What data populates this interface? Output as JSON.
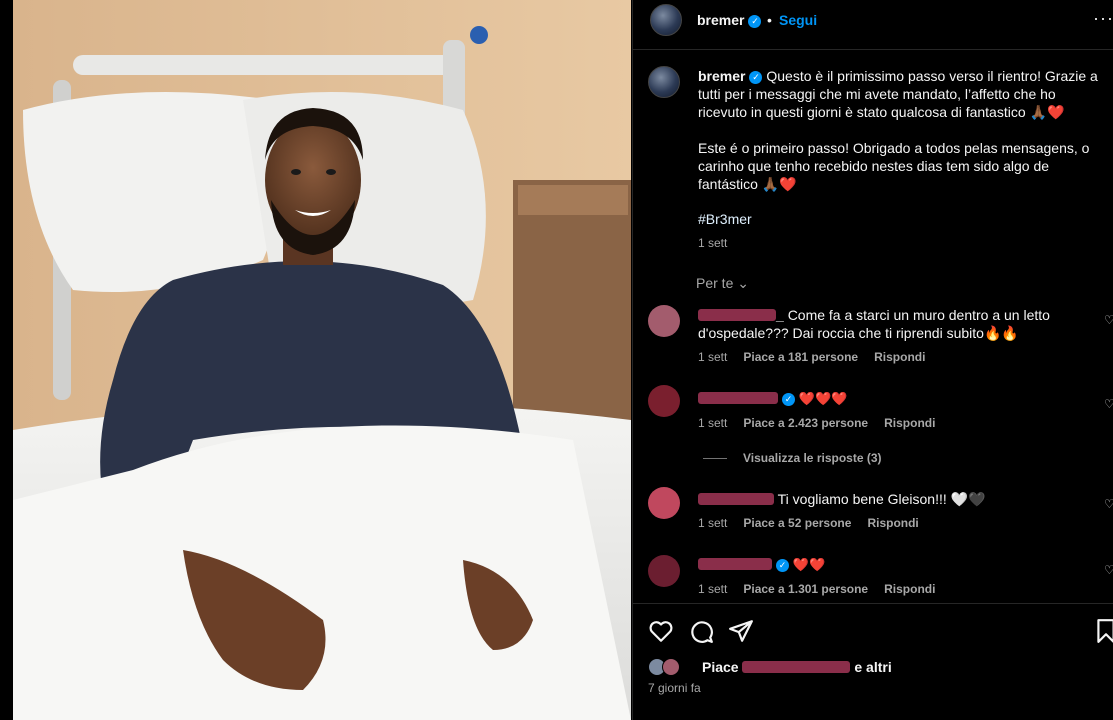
{
  "post": {
    "author": "bremer",
    "verified_mark": "✓",
    "follow_label": "Segui",
    "dot": "•",
    "more_icon": "···",
    "caption_it": "Questo è il primissimo passo verso il rientro! Grazie a tutti per i messaggi che mi avete mandato, l’affetto che ho ricevuto in questi giorni è stato qualcosa di fantastico 🙏🏾❤️",
    "caption_pt": "Este é o primeiro passo! Obrigado a todos pelas mensagens, o carinho que tenho recebido nestes dias tem sido algo de fantástico 🙏🏾❤️",
    "hashtag": "#Br3mer",
    "caption_time": "1 sett",
    "per_te": "Per te ⌄",
    "photo_icon": "hospital-bed-photo"
  },
  "comments": [
    {
      "username_suffix": "_",
      "text": "Come fa a starci un muro dentro a un letto d'ospedale??? Dai roccia che ti riprendi subito🔥🔥",
      "time": "1 sett",
      "likes": "Piace a 181 persone",
      "reply": "Rispondi",
      "avatar_color": "#a35c6d"
    },
    {
      "username_suffix": "",
      "text": "❤️❤️❤️",
      "time": "1 sett",
      "likes": "Piace a 2.423 persone",
      "reply": "Rispondi",
      "avatar_color": "#7a1f2e"
    },
    {
      "username_suffix": "",
      "text": "Ti vogliamo bene Gleison!!! 🤍🖤",
      "time": "1 sett",
      "likes": "Piace a 52 persone",
      "reply": "Rispondi",
      "avatar_color": "#c0485e"
    },
    {
      "username_suffix": "",
      "text": "❤️❤️",
      "time": "1 sett",
      "likes": "Piace a 1.301 persone",
      "reply": "Rispondi",
      "avatar_color": "#6b1e30"
    }
  ],
  "view_replies": "Visualizza le risposte (3)",
  "likes_summary": {
    "prefix": "Piace ",
    "suffix": "e altri"
  },
  "posted_ago": "7 giorni fa",
  "colors": {
    "accent": "#0095f6",
    "redaction": "#8a2e4a",
    "background": "#000000"
  }
}
